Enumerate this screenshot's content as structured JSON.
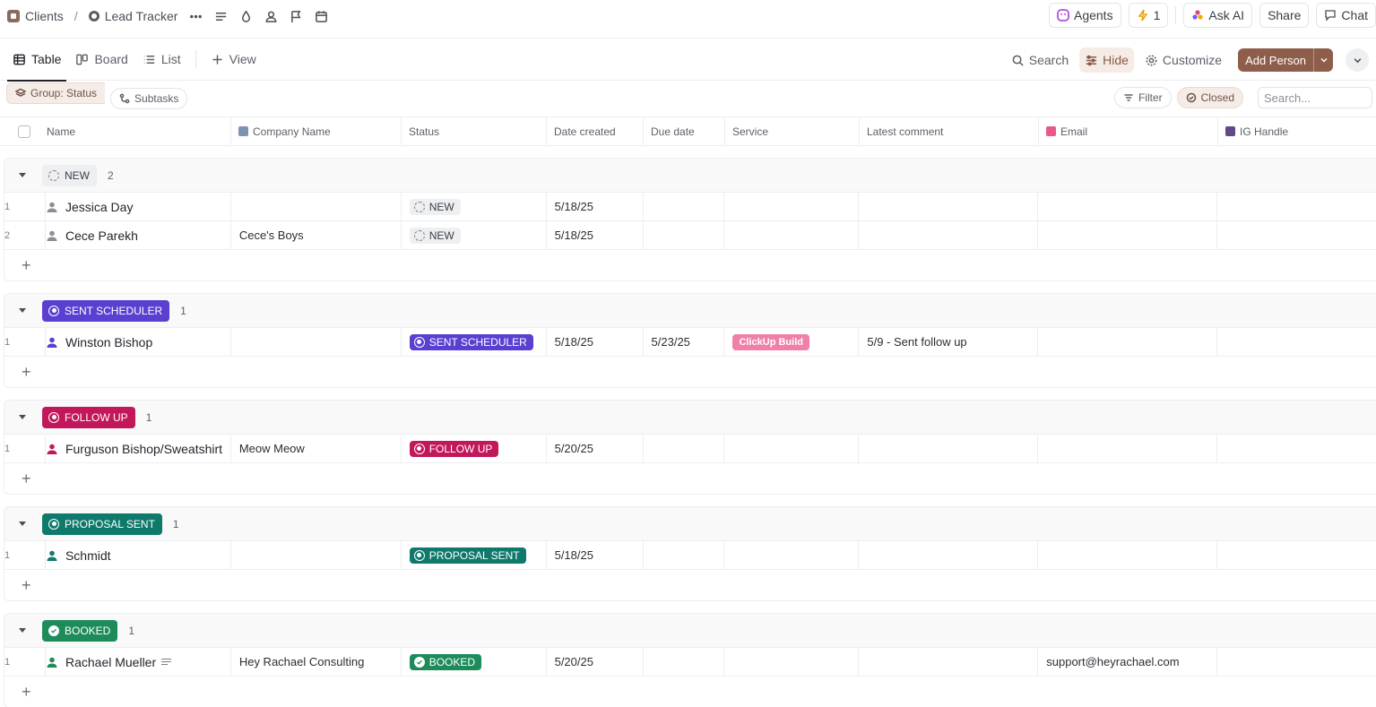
{
  "breadcrumb": {
    "space": "Clients",
    "separator": "/",
    "list": "Lead Tracker"
  },
  "top_right": {
    "agents": "Agents",
    "automations_count": "1",
    "ask_ai": "Ask AI",
    "share": "Share",
    "chat": "Chat"
  },
  "views": {
    "table": "Table",
    "board": "Board",
    "list": "List",
    "add_view": "View"
  },
  "view_actions": {
    "search": "Search",
    "hide": "Hide",
    "customize": "Customize",
    "add_person": "Add Person"
  },
  "filters": {
    "group": "Group: Status",
    "subtasks": "Subtasks",
    "filter": "Filter",
    "closed": "Closed",
    "search_placeholder": "Search..."
  },
  "columns": {
    "name": "Name",
    "company": "Company Name",
    "status": "Status",
    "created": "Date created",
    "due": "Due date",
    "service": "Service",
    "comment": "Latest comment",
    "email": "Email",
    "ig": "IG Handle"
  },
  "colors": {
    "new": "#eeeff1",
    "sent_scheduler": "#5b3fd1",
    "follow_up": "#c2185b",
    "proposal_sent": "#0f7a6c",
    "booked": "#1e8c5a",
    "service_tag": "#f07faa",
    "accent": "#8f5e4b"
  },
  "groups": [
    {
      "label": "NEW",
      "count": "2",
      "rows": [
        {
          "num": "1",
          "name": "Jessica Day",
          "company": "",
          "status": "NEW",
          "created": "5/18/25",
          "due": "",
          "service": "",
          "comment": "",
          "email": "",
          "ig": ""
        },
        {
          "num": "2",
          "name": "Cece Parekh",
          "company": "Cece's Boys",
          "status": "NEW",
          "created": "5/18/25",
          "due": "",
          "service": "",
          "comment": "",
          "email": "",
          "ig": ""
        }
      ]
    },
    {
      "label": "SENT SCHEDULER",
      "count": "1",
      "rows": [
        {
          "num": "1",
          "name": "Winston Bishop",
          "company": "",
          "status": "SENT SCHEDULER",
          "created": "5/18/25",
          "due": "5/23/25",
          "service": "ClickUp Build",
          "comment": "5/9 - Sent follow up",
          "email": "",
          "ig": ""
        }
      ]
    },
    {
      "label": "FOLLOW UP",
      "count": "1",
      "rows": [
        {
          "num": "1",
          "name": "Furguson Bishop/Sweatshirt",
          "company": "Meow Meow",
          "status": "FOLLOW UP",
          "created": "5/20/25",
          "due": "",
          "service": "",
          "comment": "",
          "email": "",
          "ig": ""
        }
      ]
    },
    {
      "label": "PROPOSAL SENT",
      "count": "1",
      "rows": [
        {
          "num": "1",
          "name": "Schmidt",
          "company": "",
          "status": "PROPOSAL SENT",
          "created": "5/18/25",
          "due": "",
          "service": "",
          "comment": "",
          "email": "",
          "ig": ""
        }
      ]
    },
    {
      "label": "BOOKED",
      "count": "1",
      "rows": [
        {
          "num": "1",
          "name": "Rachael Mueller",
          "company": "Hey Rachael Consulting",
          "status": "BOOKED",
          "created": "5/20/25",
          "due": "",
          "service": "",
          "comment": "",
          "email": "support@heyrachael.com",
          "ig": ""
        }
      ]
    }
  ]
}
